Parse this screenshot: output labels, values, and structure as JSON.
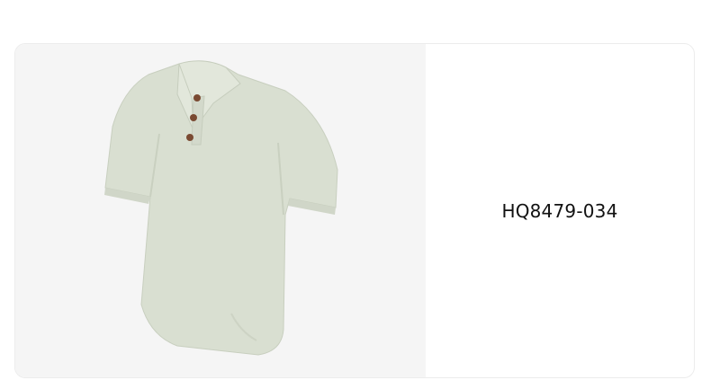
{
  "product": {
    "sku": "HQ8479-034",
    "image": {
      "icon": "polo-shirt-image",
      "shirt_color": "#d9dfd1",
      "button_color": "#7a4a32"
    }
  }
}
